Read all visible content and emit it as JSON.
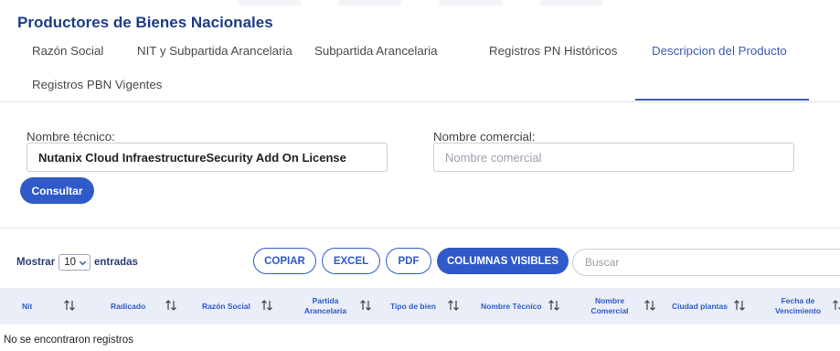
{
  "page": {
    "title": "Productores de Bienes Nacionales"
  },
  "tabs": [
    {
      "label": "Razón Social"
    },
    {
      "label": "NIT y Subpartida Arancelaria"
    },
    {
      "label": "Subpartida Arancelaria"
    },
    {
      "label": "Registros PN Históricos"
    },
    {
      "label": "Descripcion del Producto",
      "active": true
    },
    {
      "label": "Registros PBN Vigentes"
    }
  ],
  "form": {
    "nombre_tecnico_label": "Nombre técnico:",
    "nombre_tecnico_value": "Nutanix Cloud InfraestructureSecurity Add On License",
    "nombre_comercial_label": "Nombre comercial:",
    "nombre_comercial_placeholder": "Nombre comercial",
    "submit_label": "Consultar"
  },
  "table_controls": {
    "show_prefix": "Mostrar",
    "page_size": "10",
    "show_suffix": "entradas",
    "copy_label": "COPIAR",
    "excel_label": "EXCEL",
    "pdf_label": "PDF",
    "columns_label": "COLUMNAS VISIBLES",
    "search_placeholder": "Buscar"
  },
  "table": {
    "columns": [
      {
        "label": "Nit"
      },
      {
        "label": "Radicado"
      },
      {
        "label": "Razón Social"
      },
      {
        "label": "Partida Arancelaria"
      },
      {
        "label": "Tipo de bien"
      },
      {
        "label": "Nombre Técnico"
      },
      {
        "label": "Nombre Comercial"
      },
      {
        "label": "Ciudad plantas"
      },
      {
        "label": "Fecha de Vencimiento"
      }
    ],
    "empty_message": "No se encontraron registros"
  },
  "colors": {
    "primary": "#2f5ac8",
    "title": "#1f3c88",
    "header_bg": "#e9eef8"
  }
}
